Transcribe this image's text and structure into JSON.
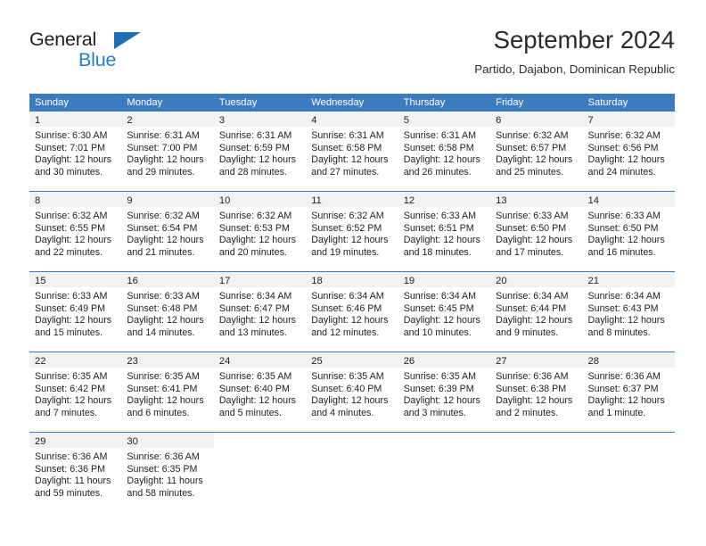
{
  "brand": {
    "word_top": "General",
    "word_bottom": "Blue",
    "triangle_color": "#1f6eb5",
    "blue_color": "#1f7fd0"
  },
  "header": {
    "title": "September 2024",
    "subtitle": "Partido, Dajabon, Dominican Republic"
  },
  "theme": {
    "header_blue": "#3c7cbe",
    "daynum_band": "#f2f2f2",
    "text": "#222222"
  },
  "calendar": {
    "weekday_headers": [
      "Sunday",
      "Monday",
      "Tuesday",
      "Wednesday",
      "Thursday",
      "Friday",
      "Saturday"
    ],
    "weeks": [
      [
        {
          "day": "1",
          "sunrise": "Sunrise: 6:30 AM",
          "sunset": "Sunset: 7:01 PM",
          "daylight1": "Daylight: 12 hours",
          "daylight2": "and 30 minutes."
        },
        {
          "day": "2",
          "sunrise": "Sunrise: 6:31 AM",
          "sunset": "Sunset: 7:00 PM",
          "daylight1": "Daylight: 12 hours",
          "daylight2": "and 29 minutes."
        },
        {
          "day": "3",
          "sunrise": "Sunrise: 6:31 AM",
          "sunset": "Sunset: 6:59 PM",
          "daylight1": "Daylight: 12 hours",
          "daylight2": "and 28 minutes."
        },
        {
          "day": "4",
          "sunrise": "Sunrise: 6:31 AM",
          "sunset": "Sunset: 6:58 PM",
          "daylight1": "Daylight: 12 hours",
          "daylight2": "and 27 minutes."
        },
        {
          "day": "5",
          "sunrise": "Sunrise: 6:31 AM",
          "sunset": "Sunset: 6:58 PM",
          "daylight1": "Daylight: 12 hours",
          "daylight2": "and 26 minutes."
        },
        {
          "day": "6",
          "sunrise": "Sunrise: 6:32 AM",
          "sunset": "Sunset: 6:57 PM",
          "daylight1": "Daylight: 12 hours",
          "daylight2": "and 25 minutes."
        },
        {
          "day": "7",
          "sunrise": "Sunrise: 6:32 AM",
          "sunset": "Sunset: 6:56 PM",
          "daylight1": "Daylight: 12 hours",
          "daylight2": "and 24 minutes."
        }
      ],
      [
        {
          "day": "8",
          "sunrise": "Sunrise: 6:32 AM",
          "sunset": "Sunset: 6:55 PM",
          "daylight1": "Daylight: 12 hours",
          "daylight2": "and 22 minutes."
        },
        {
          "day": "9",
          "sunrise": "Sunrise: 6:32 AM",
          "sunset": "Sunset: 6:54 PM",
          "daylight1": "Daylight: 12 hours",
          "daylight2": "and 21 minutes."
        },
        {
          "day": "10",
          "sunrise": "Sunrise: 6:32 AM",
          "sunset": "Sunset: 6:53 PM",
          "daylight1": "Daylight: 12 hours",
          "daylight2": "and 20 minutes."
        },
        {
          "day": "11",
          "sunrise": "Sunrise: 6:32 AM",
          "sunset": "Sunset: 6:52 PM",
          "daylight1": "Daylight: 12 hours",
          "daylight2": "and 19 minutes."
        },
        {
          "day": "12",
          "sunrise": "Sunrise: 6:33 AM",
          "sunset": "Sunset: 6:51 PM",
          "daylight1": "Daylight: 12 hours",
          "daylight2": "and 18 minutes."
        },
        {
          "day": "13",
          "sunrise": "Sunrise: 6:33 AM",
          "sunset": "Sunset: 6:50 PM",
          "daylight1": "Daylight: 12 hours",
          "daylight2": "and 17 minutes."
        },
        {
          "day": "14",
          "sunrise": "Sunrise: 6:33 AM",
          "sunset": "Sunset: 6:50 PM",
          "daylight1": "Daylight: 12 hours",
          "daylight2": "and 16 minutes."
        }
      ],
      [
        {
          "day": "15",
          "sunrise": "Sunrise: 6:33 AM",
          "sunset": "Sunset: 6:49 PM",
          "daylight1": "Daylight: 12 hours",
          "daylight2": "and 15 minutes."
        },
        {
          "day": "16",
          "sunrise": "Sunrise: 6:33 AM",
          "sunset": "Sunset: 6:48 PM",
          "daylight1": "Daylight: 12 hours",
          "daylight2": "and 14 minutes."
        },
        {
          "day": "17",
          "sunrise": "Sunrise: 6:34 AM",
          "sunset": "Sunset: 6:47 PM",
          "daylight1": "Daylight: 12 hours",
          "daylight2": "and 13 minutes."
        },
        {
          "day": "18",
          "sunrise": "Sunrise: 6:34 AM",
          "sunset": "Sunset: 6:46 PM",
          "daylight1": "Daylight: 12 hours",
          "daylight2": "and 12 minutes."
        },
        {
          "day": "19",
          "sunrise": "Sunrise: 6:34 AM",
          "sunset": "Sunset: 6:45 PM",
          "daylight1": "Daylight: 12 hours",
          "daylight2": "and 10 minutes."
        },
        {
          "day": "20",
          "sunrise": "Sunrise: 6:34 AM",
          "sunset": "Sunset: 6:44 PM",
          "daylight1": "Daylight: 12 hours",
          "daylight2": "and 9 minutes."
        },
        {
          "day": "21",
          "sunrise": "Sunrise: 6:34 AM",
          "sunset": "Sunset: 6:43 PM",
          "daylight1": "Daylight: 12 hours",
          "daylight2": "and 8 minutes."
        }
      ],
      [
        {
          "day": "22",
          "sunrise": "Sunrise: 6:35 AM",
          "sunset": "Sunset: 6:42 PM",
          "daylight1": "Daylight: 12 hours",
          "daylight2": "and 7 minutes."
        },
        {
          "day": "23",
          "sunrise": "Sunrise: 6:35 AM",
          "sunset": "Sunset: 6:41 PM",
          "daylight1": "Daylight: 12 hours",
          "daylight2": "and 6 minutes."
        },
        {
          "day": "24",
          "sunrise": "Sunrise: 6:35 AM",
          "sunset": "Sunset: 6:40 PM",
          "daylight1": "Daylight: 12 hours",
          "daylight2": "and 5 minutes."
        },
        {
          "day": "25",
          "sunrise": "Sunrise: 6:35 AM",
          "sunset": "Sunset: 6:40 PM",
          "daylight1": "Daylight: 12 hours",
          "daylight2": "and 4 minutes."
        },
        {
          "day": "26",
          "sunrise": "Sunrise: 6:35 AM",
          "sunset": "Sunset: 6:39 PM",
          "daylight1": "Daylight: 12 hours",
          "daylight2": "and 3 minutes."
        },
        {
          "day": "27",
          "sunrise": "Sunrise: 6:36 AM",
          "sunset": "Sunset: 6:38 PM",
          "daylight1": "Daylight: 12 hours",
          "daylight2": "and 2 minutes."
        },
        {
          "day": "28",
          "sunrise": "Sunrise: 6:36 AM",
          "sunset": "Sunset: 6:37 PM",
          "daylight1": "Daylight: 12 hours",
          "daylight2": "and 1 minute."
        }
      ],
      [
        {
          "day": "29",
          "sunrise": "Sunrise: 6:36 AM",
          "sunset": "Sunset: 6:36 PM",
          "daylight1": "Daylight: 11 hours",
          "daylight2": "and 59 minutes."
        },
        {
          "day": "30",
          "sunrise": "Sunrise: 6:36 AM",
          "sunset": "Sunset: 6:35 PM",
          "daylight1": "Daylight: 11 hours",
          "daylight2": "and 58 minutes."
        },
        {
          "day": "",
          "sunrise": "",
          "sunset": "",
          "daylight1": "",
          "daylight2": ""
        },
        {
          "day": "",
          "sunrise": "",
          "sunset": "",
          "daylight1": "",
          "daylight2": ""
        },
        {
          "day": "",
          "sunrise": "",
          "sunset": "",
          "daylight1": "",
          "daylight2": ""
        },
        {
          "day": "",
          "sunrise": "",
          "sunset": "",
          "daylight1": "",
          "daylight2": ""
        },
        {
          "day": "",
          "sunrise": "",
          "sunset": "",
          "daylight1": "",
          "daylight2": ""
        }
      ]
    ]
  }
}
